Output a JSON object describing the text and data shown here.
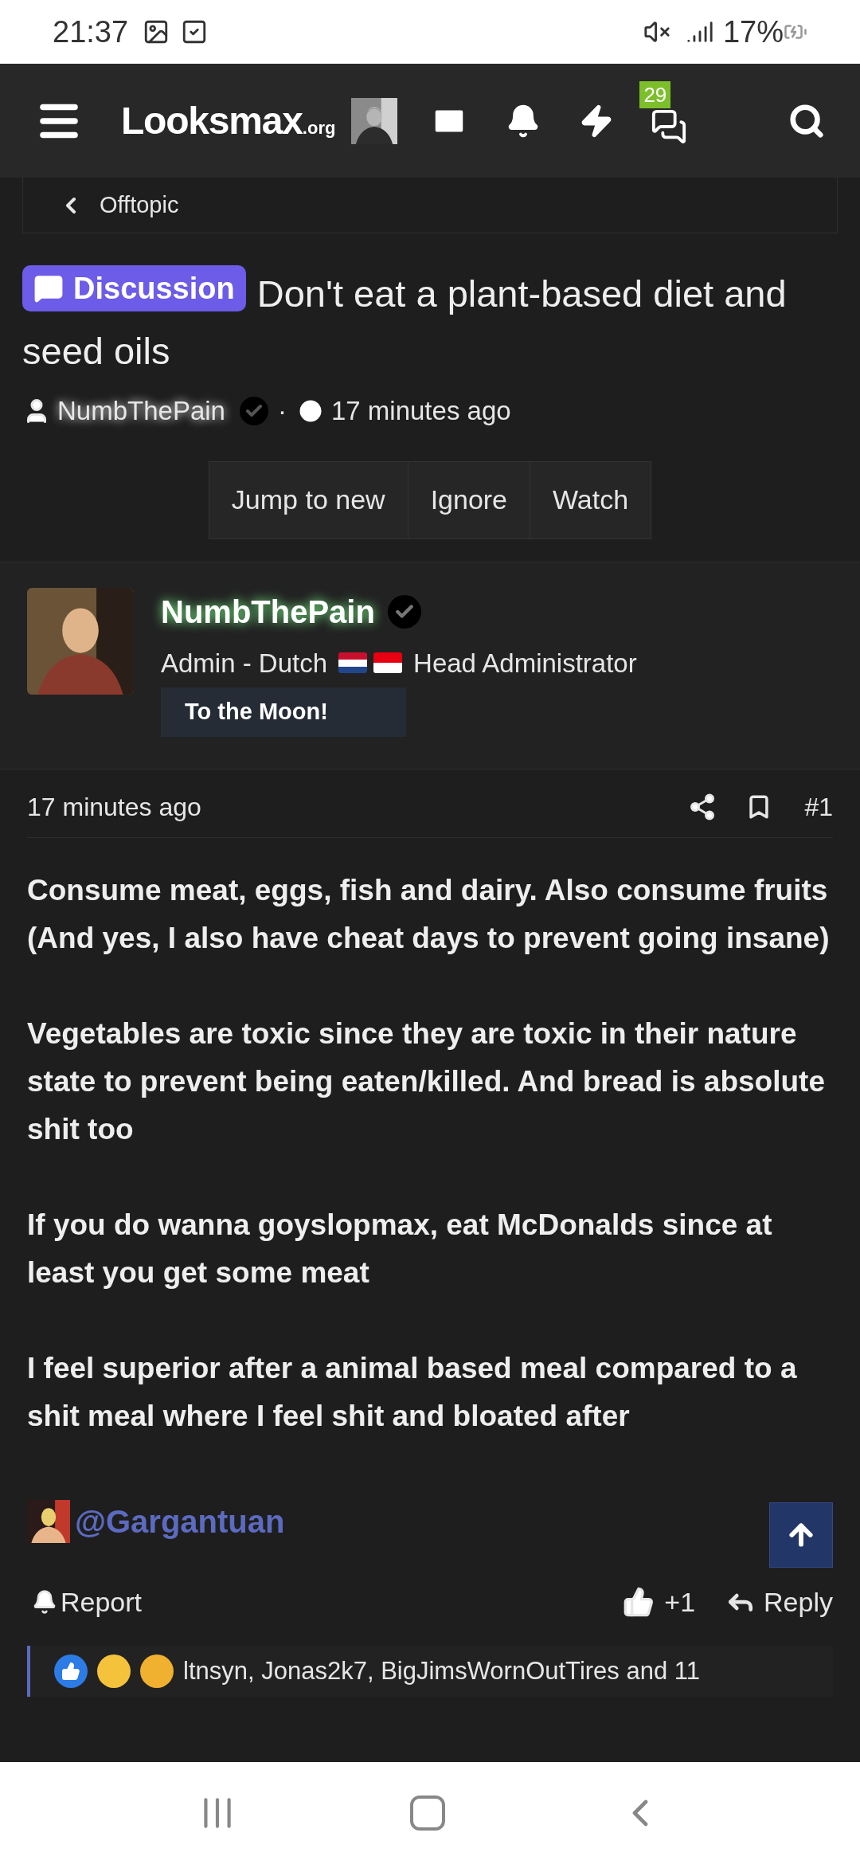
{
  "status_bar": {
    "time": "21:37",
    "battery": "17%"
  },
  "header": {
    "logo": "Looksmax",
    "logo_suffix": ".org",
    "conversations_count": "29"
  },
  "breadcrumb": {
    "label": "Offtopic"
  },
  "thread": {
    "prefix": "Discussion",
    "title": "Don't eat a plant-based diet and seed oils",
    "author": "NumbThePain",
    "separator": "·",
    "time": "17 minutes ago",
    "buttons": [
      "Jump to new",
      "Ignore",
      "Watch"
    ]
  },
  "post": {
    "author": "NumbThePain",
    "role": "Admin - Dutch",
    "title": "Head Administrator",
    "banner": "To the Moon!",
    "time": "17 minutes ago",
    "number": "#1",
    "paragraphs": [
      "Consume meat, eggs, fish and dairy. Also consume fruits (And yes, I also have cheat days to prevent going insane)",
      "Vegetables are toxic since they are toxic in their nature state to prevent being eaten/killed. And bread is absolute shit too",
      "If you do wanna goyslopmax, eat McDonalds since at least you get some meat",
      "I feel superior after a animal based meal compared to a shit meal where I feel shit and bloated after"
    ],
    "mention": "@Gargantuan",
    "actions": {
      "report": "Report",
      "like": "+1",
      "reply": "Reply"
    },
    "reactions": "ltnsyn, Jonas2k7, BigJimsWornOutTires and 11"
  }
}
